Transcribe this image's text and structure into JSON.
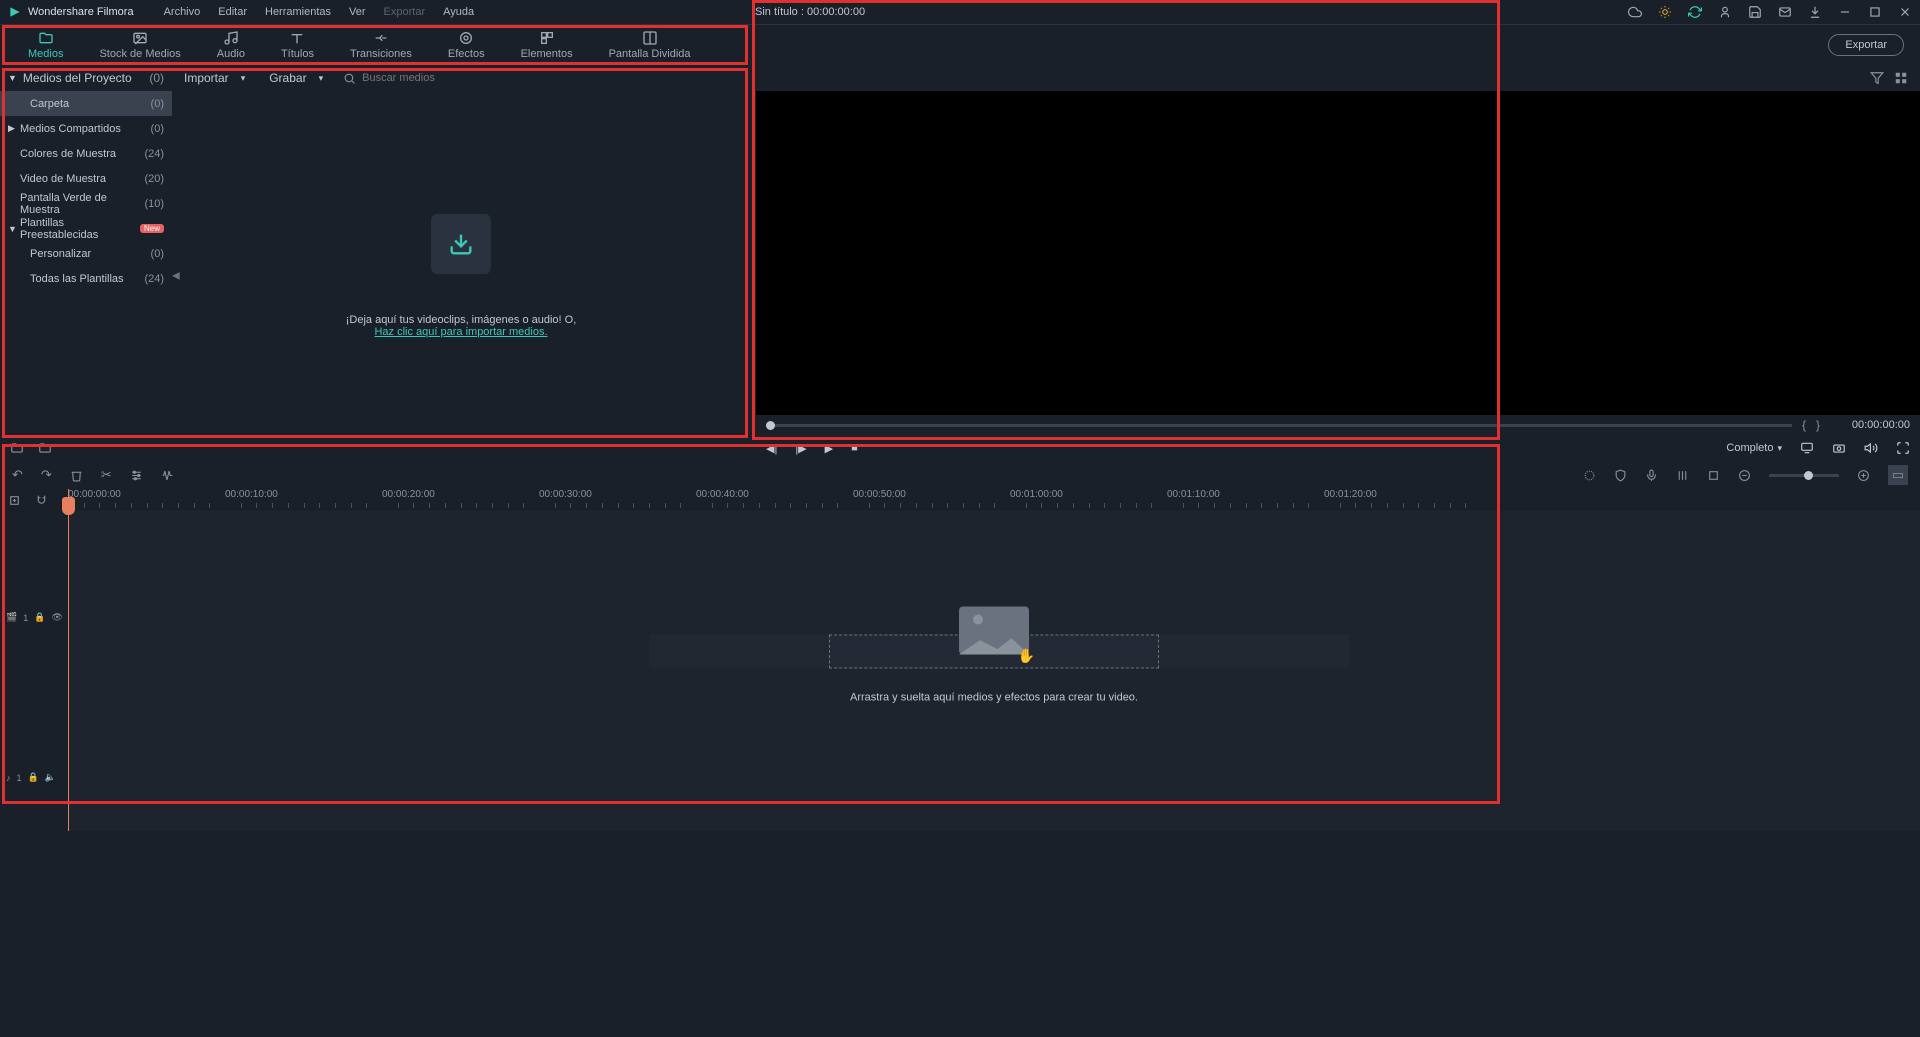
{
  "app_name": "Wondershare Filmora",
  "menu": [
    "Archivo",
    "Editar",
    "Herramientas",
    "Ver",
    "Exportar",
    "Ayuda"
  ],
  "menu_dim_index": 4,
  "doc_title": "Sin título : 00:00:00:00",
  "tabs": [
    {
      "label": "Medios"
    },
    {
      "label": "Stock de Medios"
    },
    {
      "label": "Audio"
    },
    {
      "label": "Títulos"
    },
    {
      "label": "Transiciones"
    },
    {
      "label": "Efectos"
    },
    {
      "label": "Elementos"
    },
    {
      "label": "Pantalla Dividida"
    }
  ],
  "export_label": "Exportar",
  "sub_head": {
    "label": "Medios del Proyecto",
    "count": "(0)"
  },
  "import_label": "Importar",
  "record_label": "Grabar",
  "search_placeholder": "Buscar medios",
  "side_items": [
    {
      "label": "Carpeta",
      "count": "(0)",
      "indent": true,
      "sel": true
    },
    {
      "label": "Medios Compartidos",
      "count": "(0)",
      "chev": "▶"
    },
    {
      "label": "Colores de Muestra",
      "count": "(24)"
    },
    {
      "label": "Video de Muestra",
      "count": "(20)"
    },
    {
      "label": "Pantalla Verde de Muestra",
      "count": "(10)"
    },
    {
      "label": "Plantillas Preestablecidas",
      "badge": "New",
      "chev": "▼"
    },
    {
      "label": "Personalizar",
      "count": "(0)",
      "indent": true
    },
    {
      "label": "Todas las Plantillas",
      "count": "(24)",
      "indent": true
    }
  ],
  "media_hint1": "¡Deja aquí tus videoclips, imágenes o audio! O,",
  "media_hint2": "Haz clic aquí para importar medios.",
  "preview": {
    "time": "00:00:00:00",
    "quality": "Completo"
  },
  "ruler_ticks": [
    "00:00:00:00",
    "00:00:10:00",
    "00:00:20:00",
    "00:00:30:00",
    "00:00:40:00",
    "00:00:50:00",
    "00:01:00:00",
    "00:01:10:00",
    "00:01:20:00"
  ],
  "timeline_hint": "Arrastra y suelta aquí medios y efectos para crear tu video.",
  "track_labels": {
    "video": "1",
    "audio": "1"
  }
}
